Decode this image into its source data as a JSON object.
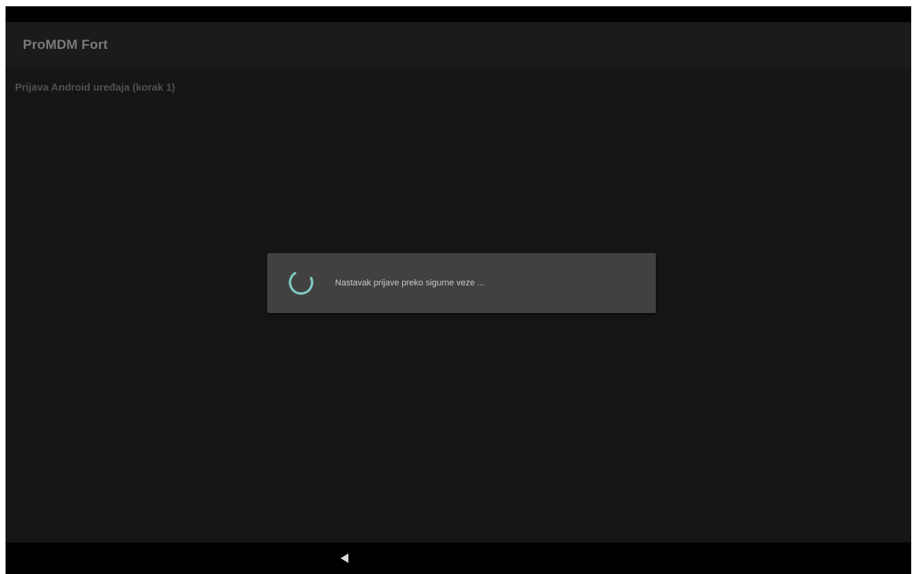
{
  "status_bar": {},
  "action_bar": {
    "app_title": "ProMDM Fort"
  },
  "content": {
    "subtitle": "Prijava Android uređaja (korak 1)"
  },
  "progress_dialog": {
    "message": "Nastavak prijave preko sigurne veze ...",
    "spinner_color": "#80cbc4"
  },
  "navigation_bar": {
    "back_icon": "back-triangle-icon"
  },
  "colors": {
    "background": "#161616",
    "action_bar": "#1b1b1b",
    "dialog": "#414141",
    "accent": "#80cbc4"
  }
}
